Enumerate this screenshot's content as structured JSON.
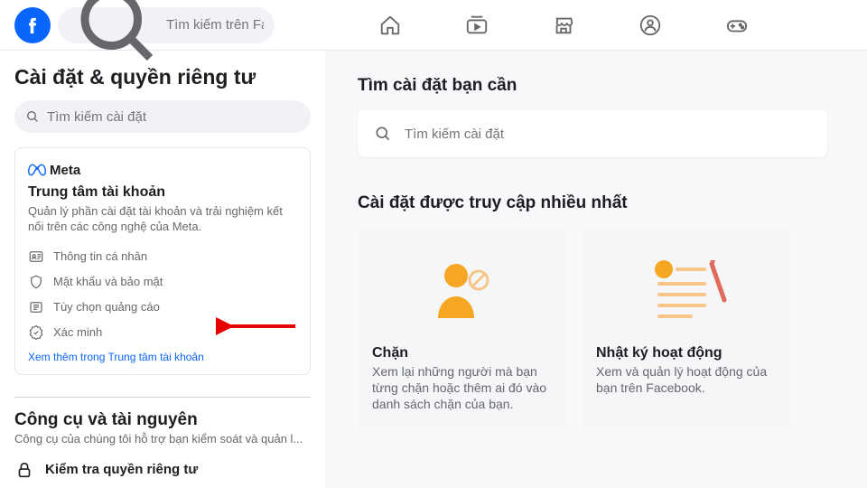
{
  "header": {
    "search_placeholder": "Tìm kiếm trên Facebook"
  },
  "sidebar": {
    "title": "Cài đặt & quyền riêng tư",
    "search_placeholder": "Tìm kiếm cài đặt",
    "meta": {
      "brand": "Meta",
      "title": "Trung tâm tài khoản",
      "desc": "Quản lý phần cài đặt tài khoản và trải nghiệm kết nối trên các công nghệ của Meta.",
      "items": [
        "Thông tin cá nhân",
        "Mật khẩu và bảo mật",
        "Tùy chọn quảng cáo",
        "Xác minh"
      ],
      "link": "Xem thêm trong Trung tâm tài khoản"
    },
    "tools": {
      "title": "Công cụ và tài nguyên",
      "desc": "Công cụ của chúng tôi hỗ trợ bạn kiểm soát và quản l...",
      "item": "Kiểm tra quyền riêng tư"
    }
  },
  "main": {
    "find_title": "Tìm cài đặt bạn cần",
    "search_placeholder": "Tìm kiếm cài đặt",
    "most_title": "Cài đặt được truy cập nhiều nhất",
    "cards": [
      {
        "title": "Chặn",
        "desc": "Xem lại những người mà bạn từng chặn hoặc thêm ai đó vào danh sách chặn của bạn."
      },
      {
        "title": "Nhật ký hoạt động",
        "desc": "Xem và quản lý hoạt động của bạn trên Facebook."
      }
    ]
  }
}
